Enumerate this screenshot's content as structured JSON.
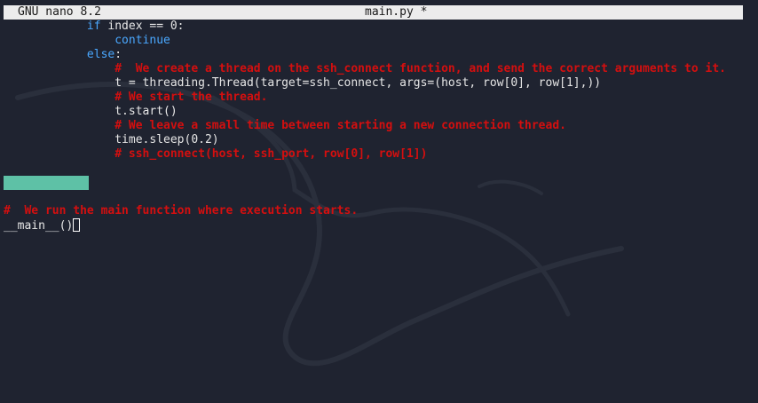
{
  "titlebar": {
    "app_name": "GNU nano 8.2",
    "file_name": "main.py *"
  },
  "code_lines": [
    {
      "indent": "            ",
      "parts": [
        {
          "t": "if",
          "c": "kw"
        },
        {
          "t": " index == 0:",
          "c": "plain"
        }
      ]
    },
    {
      "indent": "                ",
      "parts": [
        {
          "t": "continue",
          "c": "kw"
        }
      ]
    },
    {
      "indent": "            ",
      "parts": [
        {
          "t": "else",
          "c": "kw"
        },
        {
          "t": ":",
          "c": "plain"
        }
      ]
    },
    {
      "indent": "                ",
      "parts": [
        {
          "t": "#  We create a thread on the ssh_connect function, and send the correct arguments to it.",
          "c": "cm"
        }
      ]
    },
    {
      "indent": "                ",
      "parts": [
        {
          "t": "t = threading.Thread(target=ssh_connect, args=(host, row[0], row[1],))",
          "c": "plain"
        }
      ]
    },
    {
      "indent": "                ",
      "parts": [
        {
          "t": "# We start the thread.",
          "c": "cm"
        }
      ]
    },
    {
      "indent": "                ",
      "parts": [
        {
          "t": "t.start()",
          "c": "plain"
        }
      ]
    },
    {
      "indent": "                ",
      "parts": [
        {
          "t": "# We leave a small time between starting a new connection thread.",
          "c": "cm"
        }
      ]
    },
    {
      "indent": "                ",
      "parts": [
        {
          "t": "time.sleep(0.2)",
          "c": "plain"
        }
      ]
    },
    {
      "indent": "                ",
      "parts": [
        {
          "t": "# ssh_connect(host, ssh_port, row[0], row[1])",
          "c": "cm"
        }
      ]
    },
    {
      "indent": "",
      "parts": []
    },
    {
      "indent": "",
      "parts": []
    },
    {
      "indent": "",
      "parts": []
    },
    {
      "indent": "",
      "parts": [
        {
          "t": "#  We run the main function where execution starts.",
          "c": "cm"
        }
      ]
    },
    {
      "indent": "",
      "parts": [
        {
          "t": "__main__()",
          "c": "plain"
        }
      ],
      "cursor": true
    }
  ],
  "colors": {
    "background": "#1f2330",
    "keyword": "#4aa8ff",
    "comment": "#d40f0f",
    "text": "#e6e6e6",
    "marker": "#5ec1a6",
    "titlebar": "#ececec"
  }
}
